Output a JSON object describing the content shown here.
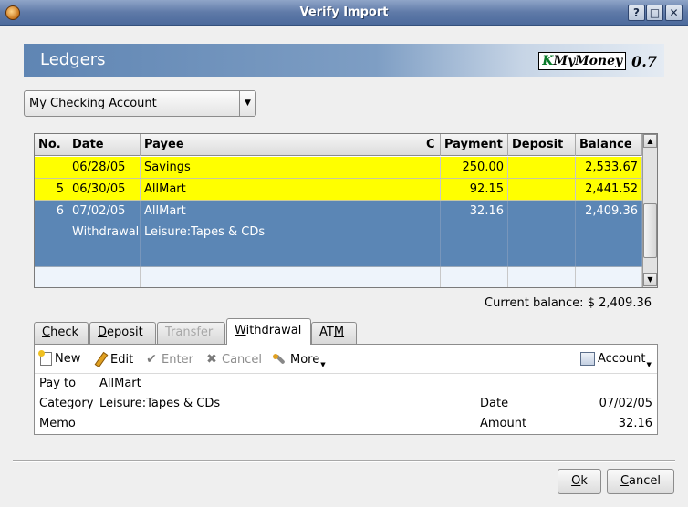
{
  "window": {
    "title": "Verify Import",
    "help_label": "?",
    "maximize_label": "□",
    "close_label": "✕"
  },
  "banner": {
    "heading": "Ledgers",
    "logo_k": "K",
    "logo_text": "MyMoney",
    "version": "0.7"
  },
  "account_select": {
    "value": "My Checking Account"
  },
  "ledger": {
    "columns": [
      "No.",
      "Date",
      "Payee",
      "C",
      "Payment",
      "Deposit",
      "Balance"
    ],
    "rows": [
      {
        "no": "",
        "date": "06/28/05",
        "payee": "Savings",
        "c": "",
        "payment": "250.00",
        "deposit": "",
        "balance": "2,533.67"
      },
      {
        "no": "5",
        "date": "06/30/05",
        "payee": "AllMart",
        "c": "",
        "payment": "92.15",
        "deposit": "",
        "balance": "2,441.52"
      },
      {
        "no": "6",
        "date": "07/02/05",
        "payee": "AllMart",
        "c": "",
        "payment": "32.16",
        "deposit": "",
        "balance": "2,409.36",
        "type": "Withdrawal",
        "category": "Leisure:Tapes & CDs"
      }
    ]
  },
  "current_balance": "Current balance: $ 2,409.36",
  "tabs": [
    {
      "label_u": "C",
      "label_rest": "heck"
    },
    {
      "label_u": "D",
      "label_rest": "eposit"
    },
    {
      "label_u": "",
      "label_rest": "Transfer"
    },
    {
      "label_u": "W",
      "label_rest": "ithdrawal"
    },
    {
      "label_pre": "AT",
      "label_u": "M"
    }
  ],
  "toolbar": {
    "new": "New",
    "edit": "Edit",
    "enter": "Enter",
    "cancel": "Cancel",
    "more": "More",
    "account": "Account"
  },
  "form": {
    "pay_to_label": "Pay to",
    "pay_to": "AllMart",
    "category_label": "Category",
    "category": "Leisure:Tapes & CDs",
    "memo_label": "Memo",
    "memo": "",
    "date_label": "Date",
    "date": "07/02/05",
    "amount_label": "Amount",
    "amount": "32.16"
  },
  "buttons": {
    "ok_u": "O",
    "ok_rest": "k",
    "cancel_u": "C",
    "cancel_rest": "ancel"
  },
  "colors": {
    "highlight_yellow": "#ffff00",
    "selection_blue": "#5b86b5"
  }
}
